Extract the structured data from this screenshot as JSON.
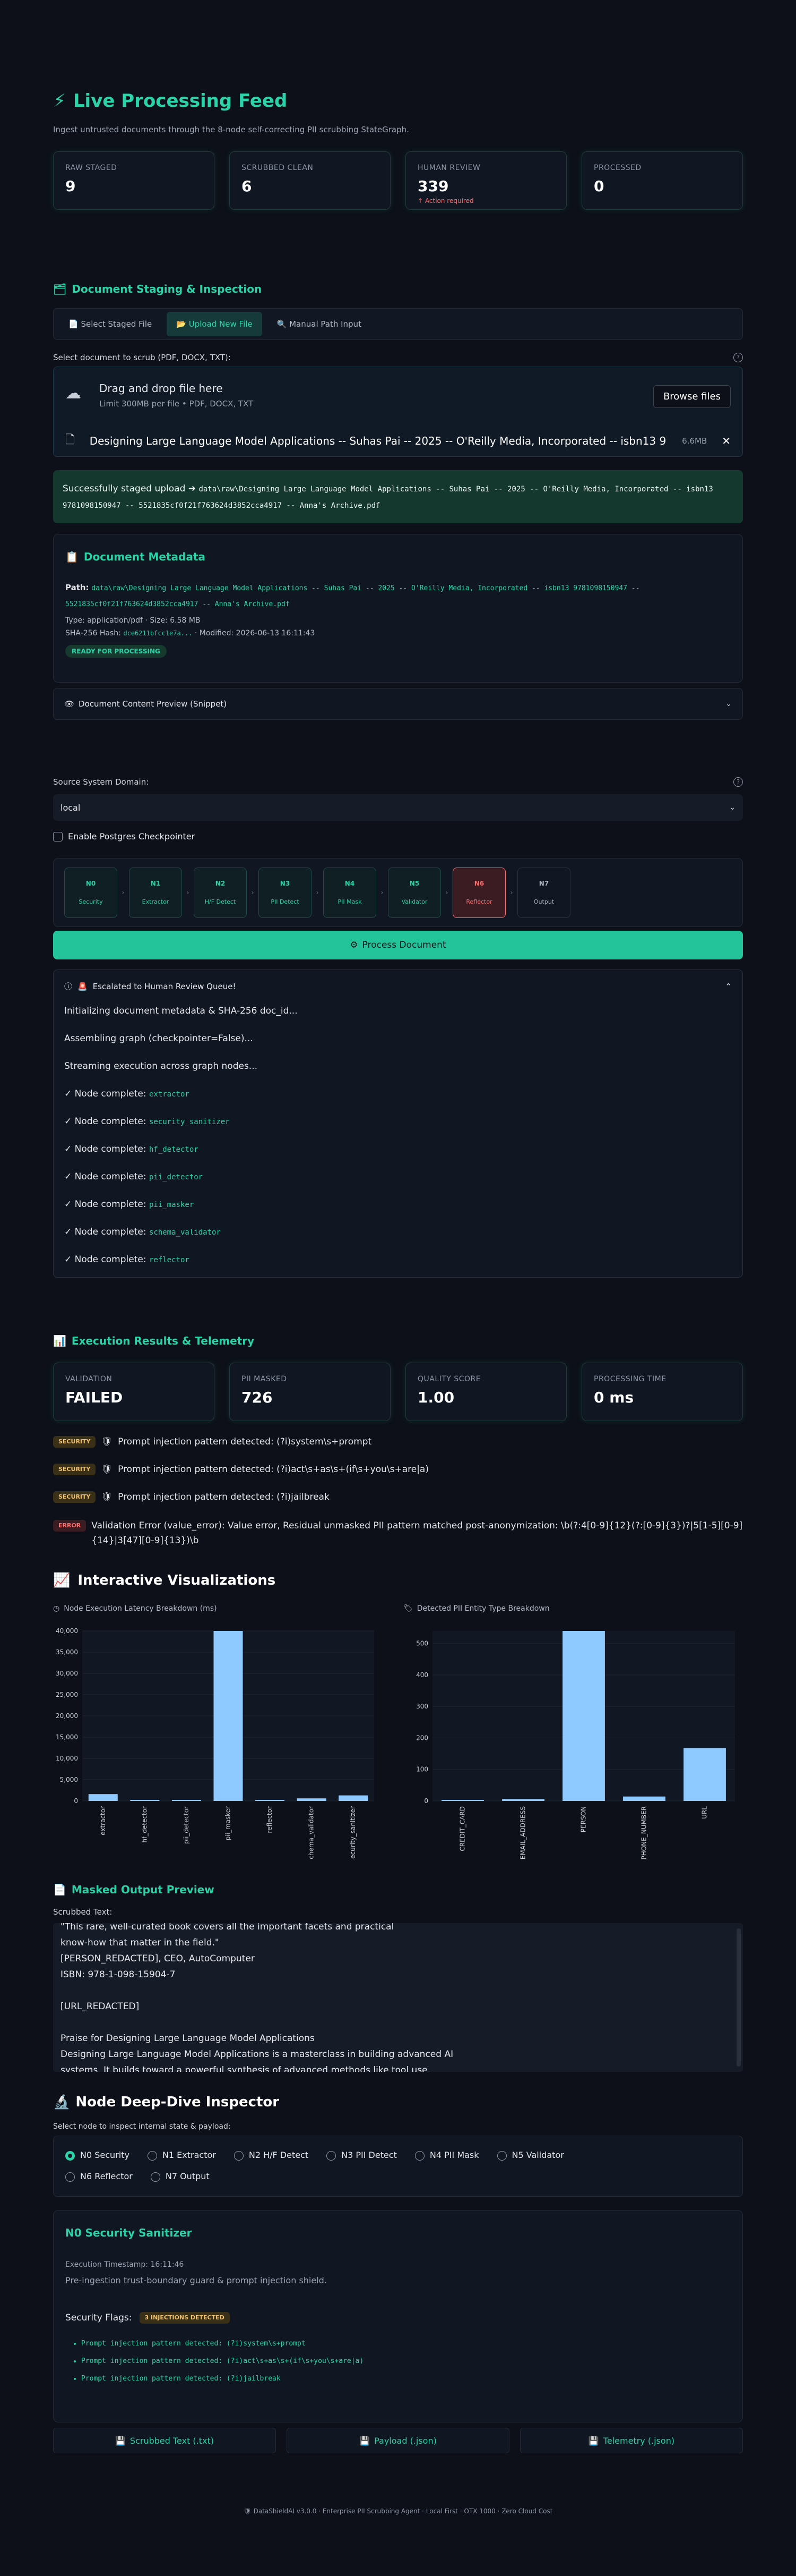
{
  "header": {
    "title": "Live Processing Feed",
    "subtitle": "Ingest untrusted documents through the 8-node self-correcting PII scrubbing StateGraph."
  },
  "metrics": [
    {
      "label": "RAW STAGED",
      "value": "9"
    },
    {
      "label": "SCRUBBED CLEAN",
      "value": "6"
    },
    {
      "label": "HUMAN REVIEW",
      "value": "339",
      "note": "Action required"
    },
    {
      "label": "PROCESSED",
      "value": "0"
    }
  ],
  "staging": {
    "title": "Document Staging & Inspection",
    "tabs": [
      "Select Staged File",
      "Upload New File",
      "Manual Path Input"
    ],
    "select_label": "Select document to scrub (PDF, DOCX, TXT):",
    "drop_title": "Drag and drop file here",
    "drop_limit": "Limit 300MB per file • PDF, DOCX, TXT",
    "browse_label": "Browse files",
    "file_name": "Designing Large Language Model Applications -- Suhas Pai -- 2025 -- O'Reilly Media, Incorporated -- isbn13 9781...",
    "file_size": "6.6MB",
    "success_text": "Successfully staged upload ➜",
    "success_path": "data\\raw\\Designing Large Language Model Applications -- Suhas Pai -- 2025 -- O'Reilly Media, Incorporated -- isbn13 9781098150947 -- 5521835cf0f21f763624d3852cca4917 -- Anna's Archive.pdf"
  },
  "metadata": {
    "title": "Document Metadata",
    "path_label": "Path:",
    "path_value": "data\\raw\\Designing Large Language Model Applications -- Suhas Pai -- 2025 -- O'Reilly Media, Incorporated -- isbn13 9781098150947 -- 5521835cf0f21f763624d3852cca4917 -- Anna's Archive.pdf",
    "type_line": "Type: application/pdf · Size: 6.58 MB",
    "hash_label": "SHA-256 Hash:",
    "hash_value": "dce6211bfcc1e7a...",
    "modified": "· Modified: 2026-06-13 16:11:43",
    "status_pill": "READY FOR PROCESSING"
  },
  "preview_expander": "Document Content Preview (Snippet)",
  "source": {
    "label": "Source System Domain:",
    "value": "local"
  },
  "checkpoint_label": "Enable Postgres Checkpointer",
  "pipeline": [
    {
      "id": "N0",
      "name": "Security",
      "state": "ok"
    },
    {
      "id": "N1",
      "name": "Extractor",
      "state": "ok"
    },
    {
      "id": "N2",
      "name": "H/F Detect",
      "state": "ok"
    },
    {
      "id": "N3",
      "name": "PII Detect",
      "state": "ok"
    },
    {
      "id": "N4",
      "name": "PII Mask",
      "state": "ok"
    },
    {
      "id": "N5",
      "name": "Validator",
      "state": "ok"
    },
    {
      "id": "N6",
      "name": "Reflector",
      "state": "err"
    },
    {
      "id": "N7",
      "name": "Output",
      "state": "idle"
    }
  ],
  "process_button": "Process Document",
  "status_box": {
    "title": "Escalated to Human Review Queue!",
    "steps": [
      {
        "text": "Initializing document metadata & SHA-256 doc_id...",
        "code": ""
      },
      {
        "text": "Assembling graph (checkpointer=False)...",
        "code": ""
      },
      {
        "text": "Streaming execution across graph nodes...",
        "code": ""
      },
      {
        "text": "✓ Node complete:",
        "code": "extractor"
      },
      {
        "text": "✓ Node complete:",
        "code": "security_sanitizer"
      },
      {
        "text": "✓ Node complete:",
        "code": "hf_detector"
      },
      {
        "text": "✓ Node complete:",
        "code": "pii_detector"
      },
      {
        "text": "✓ Node complete:",
        "code": "pii_masker"
      },
      {
        "text": "✓ Node complete:",
        "code": "schema_validator"
      },
      {
        "text": "✓ Node complete:",
        "code": "reflector"
      }
    ]
  },
  "results": {
    "title": "Execution Results & Telemetry",
    "metrics": [
      {
        "label": "VALIDATION",
        "value": "FAILED"
      },
      {
        "label": "PII MASKED",
        "value": "726"
      },
      {
        "label": "QUALITY SCORE",
        "value": "1.00"
      },
      {
        "label": "PROCESSING TIME",
        "value": "0 ms"
      }
    ],
    "flags": [
      {
        "badge": "SECURITY",
        "text": "Prompt injection pattern detected: (?i)system\\s+prompt"
      },
      {
        "badge": "SECURITY",
        "text": "Prompt injection pattern detected: (?i)act\\s+as\\s+(if\\s+you\\s+are|a)"
      },
      {
        "badge": "SECURITY",
        "text": "Prompt injection pattern detected: (?i)jailbreak"
      },
      {
        "badge": "ERROR",
        "text": "Validation Error (value_error): Value error, Residual unmasked PII pattern matched post-anonymization: \\b(?:4[0-9]{12}(?:[0-9]{3})?|5[1-5][0-9]{14}|3[47][0-9]{13})\\b"
      }
    ]
  },
  "viz": {
    "title": "Interactive Visualizations"
  },
  "chart_data": [
    {
      "type": "bar",
      "title": "Node Execution Latency Breakdown (ms)",
      "categories": [
        "extractor",
        "hf_detector",
        "pii_detector",
        "pii_masker",
        "reflector",
        "schema_validator",
        "security_sanitizer"
      ],
      "values": [
        1600,
        150,
        50,
        40000,
        50,
        600,
        1300
      ],
      "ylim": [
        0,
        40000
      ],
      "yticks": [
        0,
        5000,
        10000,
        15000,
        20000,
        25000,
        30000,
        35000,
        40000
      ],
      "ytick_labels": [
        "0",
        "5,000",
        "10,000",
        "15,000",
        "20,000",
        "25,000",
        "30,000",
        "35,000",
        "40,000"
      ],
      "color": "#8ec9ff"
    },
    {
      "type": "bar",
      "title": "Detected PII Entity Type Breakdown",
      "categories": [
        "CREDIT_CARD",
        "EMAIL_ADDRESS",
        "PERSON",
        "PHONE_NUMBER",
        "URL"
      ],
      "values": [
        1,
        6,
        540,
        14,
        168
      ],
      "ylim": [
        0,
        540
      ],
      "yticks": [
        0,
        100,
        200,
        300,
        400,
        500
      ],
      "ytick_labels": [
        "0",
        "100",
        "200",
        "300",
        "400",
        "500"
      ],
      "color": "#8ec9ff"
    }
  ],
  "masked": {
    "title": "Masked Output Preview",
    "label": "Scrubbed Text:",
    "lines": [
      "\"This rare, well-curated book covers all the important facets and practical",
      "know-how that matter in the field.\"",
      "[PERSON_REDACTED], CEO, AutoComputer",
      "ISBN:  978-1-098-15904-7",
      "",
      "[URL_REDACTED]",
      "",
      "Praise for Designing Large Language Model Applications",
      "Designing Large Language Model Applications is a masterclass in building advanced AI",
      "systems. It builds toward a powerful synthesis of advanced methods like tool use,"
    ]
  },
  "inspector": {
    "title": "Node Deep-Dive Inspector",
    "select_label": "Select node to inspect internal state & payload:",
    "options": [
      "N0 Security",
      "N1 Extractor",
      "N2 H/F Detect",
      "N3 PII Detect",
      "N4 PII Mask",
      "N5 Validator",
      "N6 Reflector",
      "N7 Output"
    ],
    "selected": "N0 Security",
    "node_title": "N0 Security Sanitizer",
    "timestamp": "Execution Timestamp: 16:11:46",
    "description": "Pre-ingestion trust-boundary guard & prompt injection shield.",
    "flags_label": "Security Flags:",
    "flags_badge": "3 INJECTIONS DETECTED",
    "flag_items": [
      "Prompt injection pattern detected: (?i)system\\s+prompt",
      "Prompt injection pattern detected: (?i)act\\s+as\\s+(if\\s+you\\s+are|a)",
      "Prompt injection pattern detected: (?i)jailbreak"
    ]
  },
  "downloads": [
    "Scrubbed Text (.txt)",
    "Payload (.json)",
    "Telemetry (.json)"
  ],
  "footer": "DataShieldAI v3.0.0 · Enterprise PII Scrubbing Agent · Local First · OTX 1000 · Zero Cloud Cost",
  "colors": {
    "accent": "#2bd4a8",
    "error": "#ff6b6b",
    "warning": "#f1c06b",
    "bar": "#8ec9ff"
  }
}
